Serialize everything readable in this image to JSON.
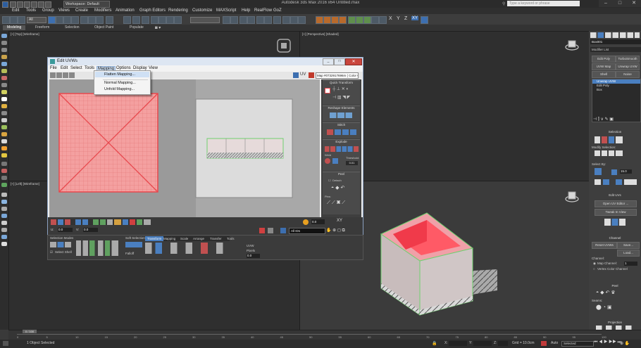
{
  "app": {
    "title": "Autodesk 3ds Max 2016 x64   Untitled.max",
    "workspace": "Workspace: Default",
    "search_placeholder": "Type a keyword or phrase"
  },
  "menu": [
    "Edit",
    "Tools",
    "Group",
    "Views",
    "Create",
    "Modifiers",
    "Animation",
    "Graph Editors",
    "Rendering",
    "Customize",
    "MAXScript",
    "Help",
    "RealFlow",
    "GoZ"
  ],
  "toolbar": {
    "axes": [
      "X",
      "Y",
      "Z",
      "XY"
    ],
    "selection_set": "All"
  },
  "ribbon_tabs": [
    "Modeling",
    "Freeform",
    "Selection",
    "Object Paint",
    "Populate"
  ],
  "viewports": {
    "top_left": "[+] [Top] [Wireframe]",
    "left": "[+] [Left] [Wireframe]",
    "perspective": "[+] [Perspective] [Shaded]"
  },
  "uvw": {
    "title": "Edit UVWs",
    "menu": [
      "File",
      "Edit",
      "Select",
      "Tools",
      "Mapping",
      "Options",
      "Display",
      "View"
    ],
    "uv_label": "UV",
    "map_dropdown": "Map #0732917696m ( Color Gr",
    "mapping_menu": [
      "Flatten Mapping...",
      "Normal Mapping...",
      "Unfold Mapping..."
    ],
    "right_panel": {
      "quick_transform": "Quick Transform",
      "reshape": "Reshape Elements",
      "stitch": "Stitch",
      "explode": "Explode",
      "weld": "Weld",
      "threshold_label": "Threshold:",
      "threshold_value": "0.01",
      "peel": "Peel",
      "detach": "Detach",
      "pins": "Pins:"
    },
    "bottom": {
      "u_value": "0.0",
      "v_value": "0.0",
      "xy_label": "XY",
      "all_ids": "All IDs",
      "zoom": "16"
    },
    "dock": {
      "selection_modes": "Selection Modes",
      "select_by_element": "Select Shell",
      "soft_select": "Soft Selection",
      "falloff": "Falloff",
      "tabs": [
        "Transform",
        "Mapping",
        "Scale",
        "Arrange",
        "Transfer",
        "Tools"
      ],
      "uvw_label": "UVW",
      "pixels_label": "Pixels",
      "value": "0.0"
    }
  },
  "command_panel": {
    "object_name": "Box001",
    "modifier_list": "Modifier List",
    "buttons": [
      "Edit Poly",
      "TurboSmooth",
      "UVW Map",
      "Unwrap UVW",
      "Shell",
      "Noise"
    ],
    "stack": [
      "Unwrap UVW",
      "Edit Poly",
      "Box"
    ],
    "selection_head": "Selection",
    "modify_selection": "Modify Selection:",
    "select_by": "Select By:",
    "angle_value": "15.0",
    "edit_uvs": "Edit UVs",
    "open_editor": "Open UV Editor ...",
    "tweak": "Tweak In View",
    "channel_head": "Channel",
    "reset_uvws": "Reset UVWs",
    "save": "Save...",
    "load": "Load...",
    "channel_label": "Channel:",
    "map_channel": "Map Channel:",
    "map_channel_value": "1",
    "vertex_color": "Vertex Color Channel",
    "peel_head": "Peel",
    "seams": "Seams:",
    "projection_head": "Projection"
  },
  "timeline": {
    "frame": "0 / 100",
    "ticks": [
      "0",
      "5",
      "10",
      "15",
      "20",
      "25",
      "30",
      "35",
      "40",
      "45",
      "50",
      "55",
      "60",
      "65",
      "70",
      "75",
      "80",
      "85",
      "90",
      "95",
      "100"
    ]
  },
  "status": {
    "selected": "1 Object Selected",
    "grid": "Grid = 10.0cm",
    "auto": "Auto",
    "selected_dd": "Selected",
    "set_key": "Set K.",
    "filters": "Filters...",
    "x": "X:",
    "y": "Y:",
    "z": "Z:"
  },
  "colors": {
    "accent": "#3d6fb0",
    "uv_red": "#e8484d",
    "selection_green": "#6fd06f"
  }
}
